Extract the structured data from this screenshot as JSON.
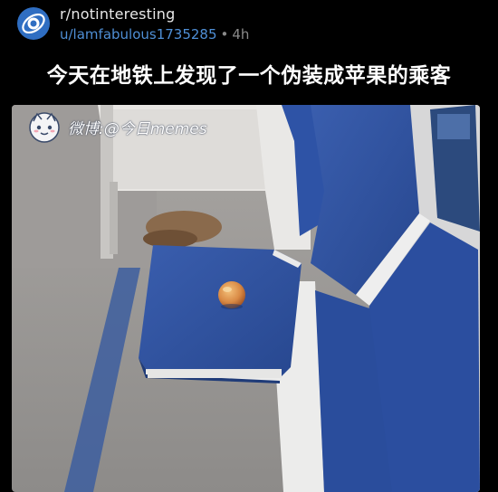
{
  "post": {
    "subreddit": "r/notinteresting",
    "username": "u/lamfabulous1735285",
    "separator": "•",
    "age": "4h",
    "title": "今天在地铁上发现了一个伪装成苹果的乘客"
  },
  "image": {
    "watermark_text": "微博:@今日memes",
    "watermark_icon": "weibo-mascot-icon"
  },
  "colors": {
    "background": "#000000",
    "username": "#4f8fd6",
    "meta_gray": "#8a8a8a",
    "seat_blue": "#2d4f9c"
  }
}
